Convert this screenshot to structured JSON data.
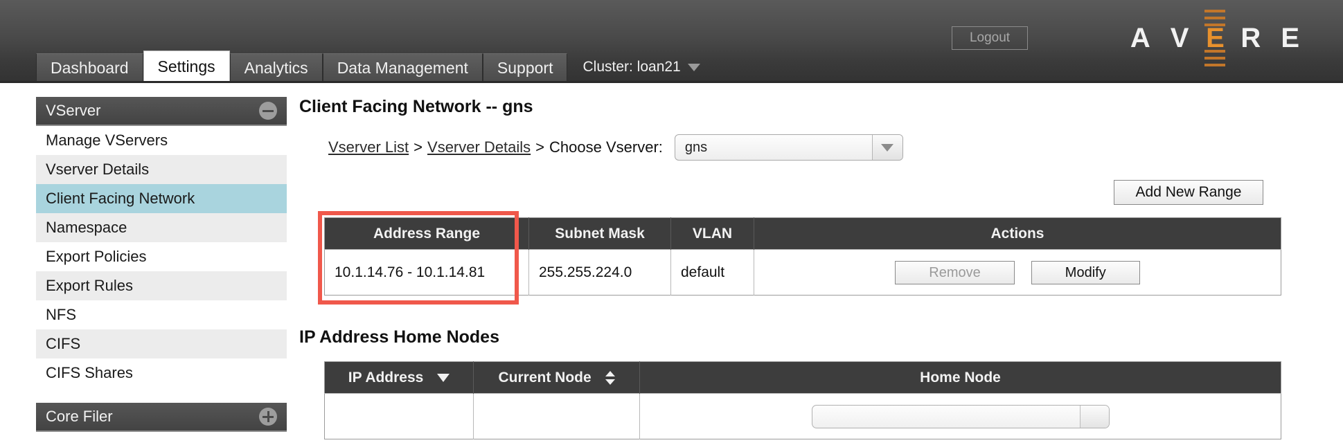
{
  "header": {
    "logout_label": "Logout",
    "logo_letters": [
      "A",
      "V",
      "E",
      "R",
      "E"
    ],
    "logo_accent_color": "#e8912d",
    "cluster_label": "Cluster: loan21"
  },
  "tabs": [
    {
      "label": "Dashboard",
      "active": false
    },
    {
      "label": "Settings",
      "active": true
    },
    {
      "label": "Analytics",
      "active": false
    },
    {
      "label": "Data Management",
      "active": false
    },
    {
      "label": "Support",
      "active": false
    }
  ],
  "sidebar": {
    "sections": [
      {
        "title": "VServer",
        "toggle": "minus-icon",
        "items": [
          {
            "label": "Manage VServers",
            "selected": false
          },
          {
            "label": "Vserver Details",
            "selected": false
          },
          {
            "label": "Client Facing Network",
            "selected": true
          },
          {
            "label": "Namespace",
            "selected": false
          },
          {
            "label": "Export Policies",
            "selected": false
          },
          {
            "label": "Export Rules",
            "selected": false
          },
          {
            "label": "NFS",
            "selected": false
          },
          {
            "label": "CIFS",
            "selected": false
          },
          {
            "label": "CIFS Shares",
            "selected": false
          }
        ]
      },
      {
        "title": "Core Filer",
        "toggle": "plus-icon",
        "items": []
      }
    ]
  },
  "main": {
    "page_title": "Client Facing Network -- gns",
    "breadcrumb": {
      "link1": "Vserver List",
      "sep1": ">",
      "link2": "Vserver Details",
      "sep2": ">",
      "label": "Choose Vserver:",
      "selected_vserver": "gns"
    },
    "add_range_label": "Add New Range",
    "ranges_table": {
      "columns": [
        "Address Range",
        "Subnet Mask",
        "VLAN",
        "Actions"
      ],
      "rows": [
        {
          "address_range": "10.1.14.76 - 10.1.14.81",
          "subnet_mask": "255.255.224.0",
          "vlan": "default",
          "remove_label": "Remove",
          "modify_label": "Modify",
          "remove_disabled": true
        }
      ],
      "highlight_color": "#f0584b"
    },
    "home_nodes": {
      "section_title": "IP Address Home Nodes",
      "columns": [
        {
          "label": "IP Address",
          "sort": "desc"
        },
        {
          "label": "Current Node",
          "sort": "both"
        },
        {
          "label": "Home Node",
          "sort": "none"
        }
      ]
    }
  }
}
